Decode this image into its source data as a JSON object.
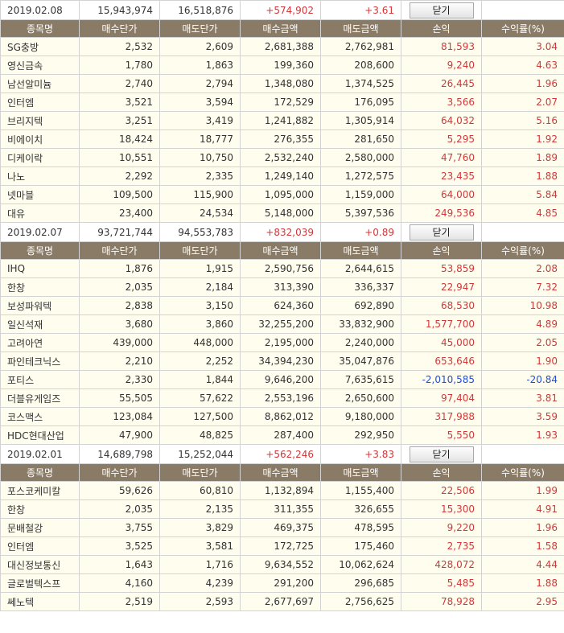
{
  "headers": [
    "종목명",
    "매수단가",
    "매도단가",
    "매수금액",
    "매도금액",
    "손익",
    "수익률(%)"
  ],
  "close_label": "닫기",
  "groups": [
    {
      "date": "2019.02.08",
      "buy_total": "15,943,974",
      "sell_total": "16,518,876",
      "profit": "+574,902",
      "rate": "+3.61",
      "rows": [
        {
          "name": "SG충방",
          "buy_price": "2,532",
          "sell_price": "2,609",
          "buy_amount": "2,681,388",
          "sell_amount": "2,762,981",
          "pnl": "81,593",
          "rate": "3.04",
          "sign": "pos"
        },
        {
          "name": "영신금속",
          "buy_price": "1,780",
          "sell_price": "1,863",
          "buy_amount": "199,360",
          "sell_amount": "208,600",
          "pnl": "9,240",
          "rate": "4.63",
          "sign": "pos"
        },
        {
          "name": "남선알미늄",
          "buy_price": "2,740",
          "sell_price": "2,794",
          "buy_amount": "1,348,080",
          "sell_amount": "1,374,525",
          "pnl": "26,445",
          "rate": "1.96",
          "sign": "pos"
        },
        {
          "name": "인터엠",
          "buy_price": "3,521",
          "sell_price": "3,594",
          "buy_amount": "172,529",
          "sell_amount": "176,095",
          "pnl": "3,566",
          "rate": "2.07",
          "sign": "pos"
        },
        {
          "name": "브리지텍",
          "buy_price": "3,251",
          "sell_price": "3,419",
          "buy_amount": "1,241,882",
          "sell_amount": "1,305,914",
          "pnl": "64,032",
          "rate": "5.16",
          "sign": "pos"
        },
        {
          "name": "비에이치",
          "buy_price": "18,424",
          "sell_price": "18,777",
          "buy_amount": "276,355",
          "sell_amount": "281,650",
          "pnl": "5,295",
          "rate": "1.92",
          "sign": "pos"
        },
        {
          "name": "디케이락",
          "buy_price": "10,551",
          "sell_price": "10,750",
          "buy_amount": "2,532,240",
          "sell_amount": "2,580,000",
          "pnl": "47,760",
          "rate": "1.89",
          "sign": "pos"
        },
        {
          "name": "나노",
          "buy_price": "2,292",
          "sell_price": "2,335",
          "buy_amount": "1,249,140",
          "sell_amount": "1,272,575",
          "pnl": "23,435",
          "rate": "1.88",
          "sign": "pos"
        },
        {
          "name": "넷마블",
          "buy_price": "109,500",
          "sell_price": "115,900",
          "buy_amount": "1,095,000",
          "sell_amount": "1,159,000",
          "pnl": "64,000",
          "rate": "5.84",
          "sign": "pos"
        },
        {
          "name": "대유",
          "buy_price": "23,400",
          "sell_price": "24,534",
          "buy_amount": "5,148,000",
          "sell_amount": "5,397,536",
          "pnl": "249,536",
          "rate": "4.85",
          "sign": "pos"
        }
      ]
    },
    {
      "date": "2019.02.07",
      "buy_total": "93,721,744",
      "sell_total": "94,553,783",
      "profit": "+832,039",
      "rate": "+0.89",
      "rows": [
        {
          "name": "IHQ",
          "buy_price": "1,876",
          "sell_price": "1,915",
          "buy_amount": "2,590,756",
          "sell_amount": "2,644,615",
          "pnl": "53,859",
          "rate": "2.08",
          "sign": "pos"
        },
        {
          "name": "한창",
          "buy_price": "2,035",
          "sell_price": "2,184",
          "buy_amount": "313,390",
          "sell_amount": "336,337",
          "pnl": "22,947",
          "rate": "7.32",
          "sign": "pos"
        },
        {
          "name": "보성파워텍",
          "buy_price": "2,838",
          "sell_price": "3,150",
          "buy_amount": "624,360",
          "sell_amount": "692,890",
          "pnl": "68,530",
          "rate": "10.98",
          "sign": "pos"
        },
        {
          "name": "일신석재",
          "buy_price": "3,680",
          "sell_price": "3,860",
          "buy_amount": "32,255,200",
          "sell_amount": "33,832,900",
          "pnl": "1,577,700",
          "rate": "4.89",
          "sign": "pos"
        },
        {
          "name": "고려아연",
          "buy_price": "439,000",
          "sell_price": "448,000",
          "buy_amount": "2,195,000",
          "sell_amount": "2,240,000",
          "pnl": "45,000",
          "rate": "2.05",
          "sign": "pos"
        },
        {
          "name": "파인테크닉스",
          "buy_price": "2,210",
          "sell_price": "2,252",
          "buy_amount": "34,394,230",
          "sell_amount": "35,047,876",
          "pnl": "653,646",
          "rate": "1.90",
          "sign": "pos"
        },
        {
          "name": "포티스",
          "buy_price": "2,330",
          "sell_price": "1,844",
          "buy_amount": "9,646,200",
          "sell_amount": "7,635,615",
          "pnl": "-2,010,585",
          "rate": "-20.84",
          "sign": "neg"
        },
        {
          "name": "더블유게임즈",
          "buy_price": "55,505",
          "sell_price": "57,622",
          "buy_amount": "2,553,196",
          "sell_amount": "2,650,600",
          "pnl": "97,404",
          "rate": "3.81",
          "sign": "pos"
        },
        {
          "name": "코스맥스",
          "buy_price": "123,084",
          "sell_price": "127,500",
          "buy_amount": "8,862,012",
          "sell_amount": "9,180,000",
          "pnl": "317,988",
          "rate": "3.59",
          "sign": "pos"
        },
        {
          "name": "HDC현대산업",
          "buy_price": "47,900",
          "sell_price": "48,825",
          "buy_amount": "287,400",
          "sell_amount": "292,950",
          "pnl": "5,550",
          "rate": "1.93",
          "sign": "pos"
        }
      ]
    },
    {
      "date": "2019.02.01",
      "buy_total": "14,689,798",
      "sell_total": "15,252,044",
      "profit": "+562,246",
      "rate": "+3.83",
      "rows": [
        {
          "name": "포스코케미칼",
          "buy_price": "59,626",
          "sell_price": "60,810",
          "buy_amount": "1,132,894",
          "sell_amount": "1,155,400",
          "pnl": "22,506",
          "rate": "1.99",
          "sign": "pos"
        },
        {
          "name": "한창",
          "buy_price": "2,035",
          "sell_price": "2,135",
          "buy_amount": "311,355",
          "sell_amount": "326,655",
          "pnl": "15,300",
          "rate": "4.91",
          "sign": "pos"
        },
        {
          "name": "문배철강",
          "buy_price": "3,755",
          "sell_price": "3,829",
          "buy_amount": "469,375",
          "sell_amount": "478,595",
          "pnl": "9,220",
          "rate": "1.96",
          "sign": "pos"
        },
        {
          "name": "인터엠",
          "buy_price": "3,525",
          "sell_price": "3,581",
          "buy_amount": "172,725",
          "sell_amount": "175,460",
          "pnl": "2,735",
          "rate": "1.58",
          "sign": "pos"
        },
        {
          "name": "대신정보통신",
          "buy_price": "1,643",
          "sell_price": "1,716",
          "buy_amount": "9,634,552",
          "sell_amount": "10,062,624",
          "pnl": "428,072",
          "rate": "4.44",
          "sign": "pos"
        },
        {
          "name": "글로벌텍스프",
          "buy_price": "4,160",
          "sell_price": "4,239",
          "buy_amount": "291,200",
          "sell_amount": "296,685",
          "pnl": "5,485",
          "rate": "1.88",
          "sign": "pos"
        },
        {
          "name": "쎄노텍",
          "buy_price": "2,519",
          "sell_price": "2,593",
          "buy_amount": "2,677,697",
          "sell_amount": "2,756,625",
          "pnl": "78,928",
          "rate": "2.95",
          "sign": "pos"
        }
      ]
    }
  ],
  "colors": {
    "header_bg": "#8a7b66",
    "row_bg": "#fffdee",
    "positive": "#d2383a",
    "negative": "#1f4fd6"
  }
}
